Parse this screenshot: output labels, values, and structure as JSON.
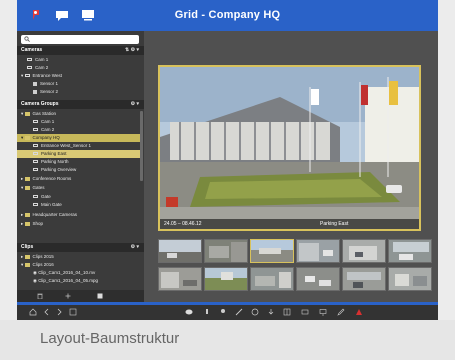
{
  "window": {
    "title": "Grid - Company HQ"
  },
  "sidebar": {
    "sections": {
      "cameras": "Cameras",
      "camera_groups": "Camera Groups",
      "clips": "Clips"
    },
    "cameras": [
      "Cam 1",
      "Cam 2",
      "Entrance West",
      "Sensor 1",
      "Sensor 2"
    ],
    "groups": [
      {
        "label": "Gas Station"
      },
      {
        "label": "Cam 1"
      },
      {
        "label": "Cam 2"
      },
      {
        "label": "Company HQ"
      },
      {
        "label": "Entrance West_Sensor 1"
      },
      {
        "label": "Parking East"
      },
      {
        "label": "Parking North"
      },
      {
        "label": "Parking Overview"
      },
      {
        "label": "Conference Rooms"
      },
      {
        "label": "Gates"
      },
      {
        "label": "Gate"
      },
      {
        "label": "Main Gate"
      },
      {
        "label": "Headquarter Cameras"
      },
      {
        "label": "Shop"
      }
    ],
    "clips": [
      {
        "label": "Clips 2015"
      },
      {
        "label": "Clips 2016"
      },
      {
        "label": "Clip_Cam1_2016_04_10.mv"
      },
      {
        "label": "Clip_Cam1_2016_04_05.mpg"
      }
    ]
  },
  "main": {
    "view_caption_time": "24.05 – 08.46.12",
    "view_caption_name": "Parking East"
  },
  "caption": "Layout-Baumstruktur"
}
